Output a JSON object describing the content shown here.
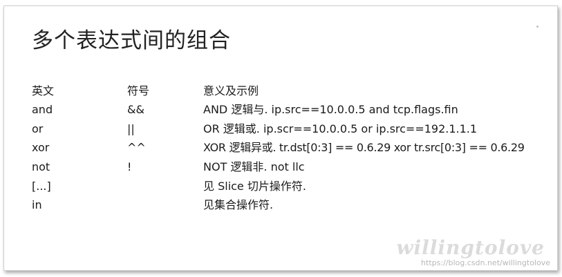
{
  "title": "多个表达式间的组合",
  "header": {
    "col1": "英文",
    "col2": "符号",
    "col3": "意义及示例"
  },
  "rows": [
    {
      "en": "and",
      "sym": "&&",
      "desc": "AND 逻辑与. ip.src==10.0.0.5 and tcp.flags.fin"
    },
    {
      "en": "or",
      "sym": "||",
      "desc": "OR 逻辑或. ip.scr==10.0.0.5 or ip.src==192.1.1.1"
    },
    {
      "en": "xor",
      "sym": "^^",
      "desc": "XOR 逻辑异或. tr.dst[0:3] == 0.6.29 xor tr.src[0:3] == 0.6.29"
    },
    {
      "en": "not",
      "sym": "!",
      "desc": "NOT 逻辑非. not llc"
    },
    {
      "en": "[...]",
      "sym": "",
      "desc": "见 Slice 切片操作符."
    },
    {
      "en": "in",
      "sym": "",
      "desc": "见集合操作符."
    }
  ],
  "watermark": {
    "logo_text": "willingtolove",
    "url": "https://blog.csdn.net/willingtolove"
  }
}
